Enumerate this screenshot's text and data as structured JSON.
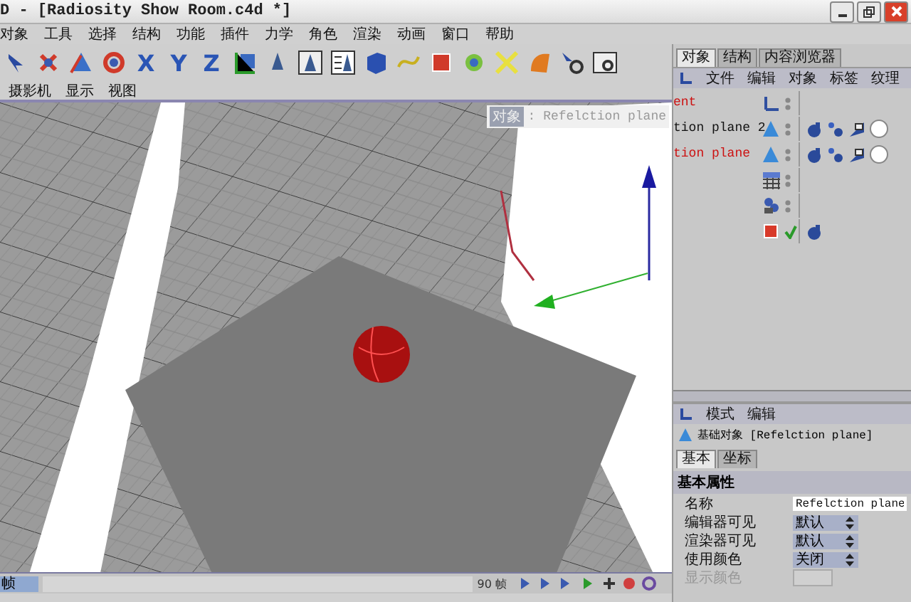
{
  "window": {
    "title": "D - [Radiosity Show Room.c4d *]"
  },
  "menu": [
    "对象",
    "工具",
    "选择",
    "结构",
    "功能",
    "插件",
    "力学",
    "角色",
    "渲染",
    "动画",
    "窗口",
    "帮助"
  ],
  "toolbar": {
    "axis_locks": [
      "X",
      "Y",
      "Z"
    ]
  },
  "viewport": {
    "menu": [
      "摄影机",
      "显示",
      "视图"
    ],
    "label_prefix": "对象",
    "label": ": Refelction plane"
  },
  "timeline": {
    "frame_field": "帧",
    "frame": "90 帧"
  },
  "object_manager": {
    "tabs": [
      {
        "label": "对象",
        "selected": true
      },
      {
        "label": "结构",
        "selected": false
      },
      {
        "label": "内容浏览器",
        "selected": false
      }
    ],
    "menu": [
      "文件",
      "编辑",
      "对象",
      "标签",
      "纹理"
    ],
    "objects": [
      {
        "name": "ent",
        "color": "#cc1111",
        "kind": "null",
        "checked": false
      },
      {
        "name": "tion plane 2",
        "color": "#111111",
        "kind": "plane",
        "checked": false,
        "tags": [
          {
            "kind": "material"
          },
          {
            "kind": "link"
          },
          {
            "kind": "texture"
          },
          {
            "kind": "sphere"
          }
        ]
      },
      {
        "name": "tion plane",
        "color": "#cc1111",
        "kind": "plane",
        "checked": false,
        "tags": [
          {
            "kind": "material"
          },
          {
            "kind": "link"
          },
          {
            "kind": "texture"
          },
          {
            "kind": "sphere"
          }
        ]
      },
      {
        "kind": "floor",
        "checked": false
      },
      {
        "kind": "camera",
        "checked": false
      },
      {
        "kind": "cube",
        "checked": true,
        "tags": [
          {
            "kind": "material"
          }
        ]
      }
    ]
  },
  "attribute_manager": {
    "menu": [
      "模式",
      "编辑"
    ],
    "object_title": "基础对象 [Refelction plane]",
    "tabs": [
      {
        "label": "基本",
        "selected": true
      },
      {
        "label": "坐标",
        "selected": false
      }
    ],
    "section": "基本属性",
    "fields": [
      {
        "label": "名称",
        "kind": "text",
        "value": "Refelction plane",
        "disabled": false
      },
      {
        "label": "编辑器可见",
        "kind": "select",
        "value": "默认",
        "disabled": false
      },
      {
        "label": "渲染器可见",
        "kind": "select",
        "value": "默认",
        "disabled": false
      },
      {
        "label": "使用颜色",
        "kind": "select",
        "value": "关闭",
        "disabled": false
      },
      {
        "label": "显示颜色",
        "kind": "color",
        "disabled": true
      }
    ]
  }
}
